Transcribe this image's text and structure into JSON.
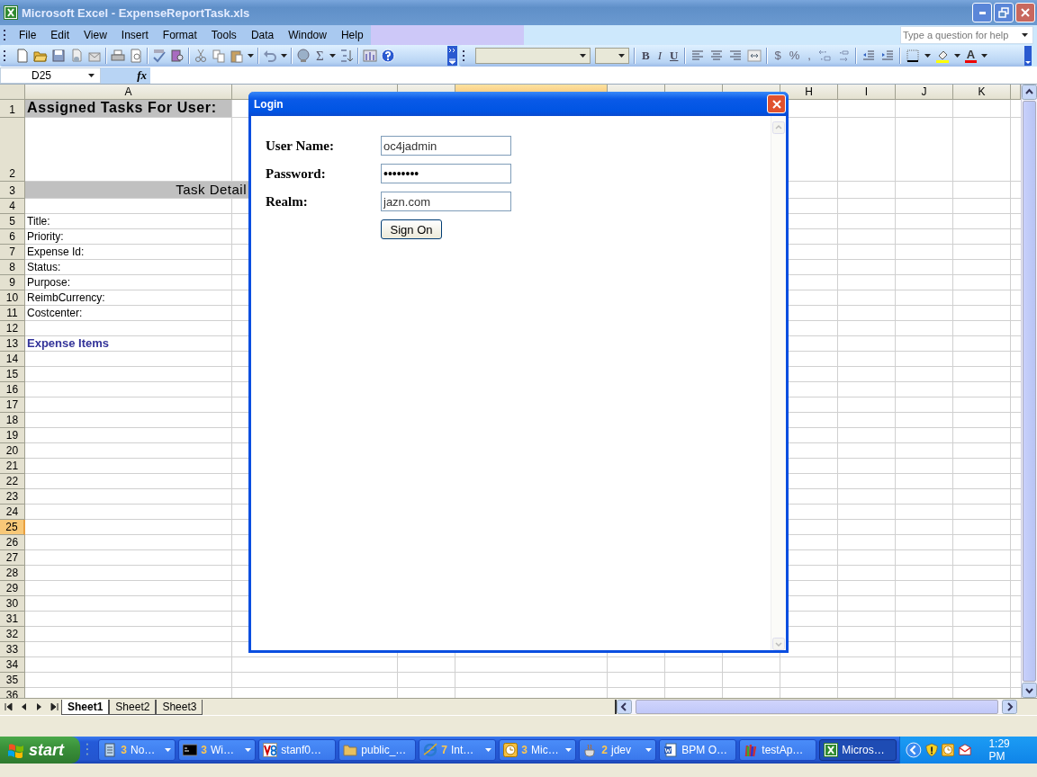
{
  "window": {
    "title": "Microsoft Excel - ExpenseReportTask.xls"
  },
  "menu": [
    {
      "label": "File"
    },
    {
      "label": "Edit"
    },
    {
      "label": "View"
    },
    {
      "label": "Insert"
    },
    {
      "label": "Format"
    },
    {
      "label": "Tools"
    },
    {
      "label": "Data"
    },
    {
      "label": "Window"
    },
    {
      "label": "Help"
    }
  ],
  "help_box": {
    "placeholder": "Type a question for help"
  },
  "standard_toolbar": {
    "sum": "Σ"
  },
  "format_buttons": [
    {
      "kind": "bold",
      "label": "B"
    },
    {
      "kind": "italic",
      "label": "I"
    },
    {
      "kind": "underline",
      "label": "U"
    },
    {
      "kind": "align-left"
    },
    {
      "kind": "align-center"
    },
    {
      "kind": "align-right"
    },
    {
      "kind": "merge"
    },
    {
      "kind": "currency",
      "label": "$"
    },
    {
      "kind": "percent",
      "label": "%"
    },
    {
      "kind": "comma",
      "label": ","
    },
    {
      "kind": "increase-decimal"
    },
    {
      "kind": "decrease-decimal"
    },
    {
      "kind": "outdent"
    },
    {
      "kind": "indent"
    },
    {
      "kind": "borders"
    },
    {
      "kind": "fill-color"
    },
    {
      "kind": "font-color",
      "label": "A"
    }
  ],
  "name_box": "D25",
  "formula_label": "fx",
  "columns": [
    {
      "label": "A",
      "selected": false
    },
    {
      "selected": false
    },
    {
      "selected": false
    },
    {
      "selected": true
    },
    {
      "selected": false
    },
    {
      "selected": false
    },
    {
      "selected": false
    },
    {
      "label": "H",
      "selected": false
    },
    {
      "label": "I",
      "selected": false
    },
    {
      "label": "J",
      "selected": false
    },
    {
      "label": "K",
      "selected": false
    }
  ],
  "rows": [
    {
      "number": "1",
      "selected": false,
      "kind": "title",
      "text": "Assigned Tasks For User:"
    },
    {
      "number": "2",
      "selected": false,
      "kind": "tall"
    },
    {
      "number": "3",
      "selected": false,
      "kind": "header",
      "text": "Task Detail"
    },
    {
      "number": "4",
      "selected": false,
      "kind": "empty"
    },
    {
      "number": "5",
      "selected": false,
      "kind": "label",
      "text": "Title:"
    },
    {
      "number": "6",
      "selected": false,
      "kind": "label",
      "text": "Priority:"
    },
    {
      "number": "7",
      "selected": false,
      "kind": "label",
      "text": "Expense Id:"
    },
    {
      "number": "8",
      "selected": false,
      "kind": "label",
      "text": "Status:"
    },
    {
      "number": "9",
      "selected": false,
      "kind": "label",
      "text": "Purpose:"
    },
    {
      "number": "10",
      "selected": false,
      "kind": "label",
      "text": "ReimbCurrency:"
    },
    {
      "number": "11",
      "selected": false,
      "kind": "label",
      "text": "Costcenter:"
    },
    {
      "number": "12",
      "selected": false,
      "kind": "empty"
    },
    {
      "number": "13",
      "selected": false,
      "kind": "section",
      "text": "Expense Items"
    },
    {
      "number": "14",
      "selected": false,
      "kind": "empty"
    },
    {
      "number": "15",
      "selected": false,
      "kind": "empty"
    },
    {
      "number": "16",
      "selected": false,
      "kind": "empty"
    },
    {
      "number": "17",
      "selected": false,
      "kind": "empty"
    },
    {
      "number": "18",
      "selected": false,
      "kind": "empty"
    },
    {
      "number": "19",
      "selected": false,
      "kind": "empty"
    },
    {
      "number": "20",
      "selected": false,
      "kind": "empty"
    },
    {
      "number": "21",
      "selected": false,
      "kind": "empty"
    },
    {
      "number": "22",
      "selected": false,
      "kind": "empty"
    },
    {
      "number": "23",
      "selected": false,
      "kind": "empty"
    },
    {
      "number": "24",
      "selected": false,
      "kind": "empty"
    },
    {
      "number": "25",
      "selected": true,
      "kind": "empty"
    },
    {
      "number": "26",
      "selected": false,
      "kind": "empty"
    },
    {
      "number": "27",
      "selected": false,
      "kind": "empty"
    },
    {
      "number": "28",
      "selected": false,
      "kind": "empty"
    },
    {
      "number": "29",
      "selected": false,
      "kind": "empty"
    },
    {
      "number": "30",
      "selected": false,
      "kind": "empty"
    },
    {
      "number": "31",
      "selected": false,
      "kind": "empty"
    },
    {
      "number": "32",
      "selected": false,
      "kind": "empty"
    },
    {
      "number": "33",
      "selected": false,
      "kind": "empty"
    },
    {
      "number": "34",
      "selected": false,
      "kind": "empty"
    },
    {
      "number": "35",
      "selected": false,
      "kind": "empty"
    },
    {
      "number": "36",
      "selected": false,
      "kind": "empty"
    }
  ],
  "sheet_tabs": [
    {
      "label": "Sheet1",
      "selected": true
    },
    {
      "label": "Sheet2",
      "selected": false
    },
    {
      "label": "Sheet3",
      "selected": false
    }
  ],
  "dialog": {
    "title": "Login",
    "fields": [
      {
        "label": "User Name:",
        "value": "oc4jadmin",
        "kind": "text"
      },
      {
        "label": "Password:",
        "value": "••••••••",
        "kind": "password"
      },
      {
        "label": "Realm:",
        "value": "jazn.com",
        "kind": "text"
      }
    ],
    "button": "Sign On"
  },
  "taskbar": {
    "start": "start",
    "tasks": [
      {
        "kind": "notepad",
        "count": "3",
        "label": "No…",
        "selected": false
      },
      {
        "kind": "console",
        "count": "3",
        "label": "Wi…",
        "selected": false
      },
      {
        "kind": "vnc",
        "label": "stanf0…",
        "selected": false
      },
      {
        "kind": "folder",
        "label": "public_…",
        "selected": false
      },
      {
        "kind": "browser",
        "count": "7",
        "label": "Int…",
        "selected": false
      },
      {
        "kind": "clock",
        "count": "3",
        "label": "Mic…",
        "selected": false
      },
      {
        "kind": "cup",
        "count": "2",
        "label": "jdev",
        "selected": false
      },
      {
        "kind": "document",
        "label": "BPM O…",
        "selected": false
      },
      {
        "kind": "pencils",
        "label": "testAp…",
        "selected": false
      },
      {
        "kind": "spreadsheet",
        "label": "Micros…",
        "selected": true
      }
    ],
    "clock": "1:29 PM"
  }
}
